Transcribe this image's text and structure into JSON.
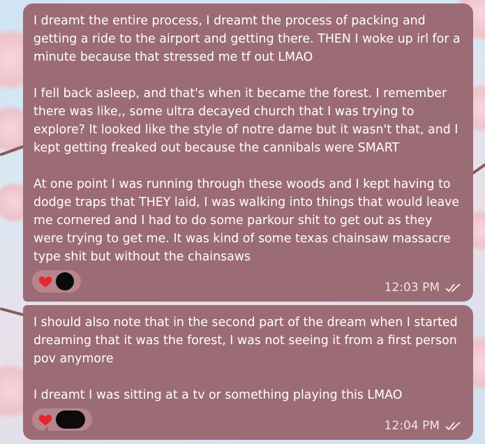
{
  "colors": {
    "bubble": "#9b6b76",
    "reaction_pill": "#b8858f",
    "text": "#ffffff",
    "time": "#f3e5e8",
    "heart": "#e8242f"
  },
  "messages": [
    {
      "paragraphs": [
        "I dreamt the entire process, I dreamt the process of packing and getting a ride to the airport and getting there. THEN I woke up irl for a minute because that stressed me tf out LMAO",
        "I fell back asleep, and that's when it became the forest. I remember there was like,, some ultra decayed church that I was trying to explore? It looked like the style of notre dame but it wasn't that, and I kept getting freaked out because the cannibals were SMART",
        "At one point I was running through these woods and I kept having to dodge traps that THEY laid, I was walking into things that would leave me cornered and I had to do some parkour shit to get out as they were trying to get me. It was kind of some texas chainsaw massacre type shit but without the chainsaws"
      ],
      "reaction": "heart-icon",
      "time": "12:03 PM",
      "status": "read-double-check-icon"
    },
    {
      "paragraphs": [
        "I should also note that in the second part of the dream when I started dreaming that it was the forest, I was not seeing it from a first person pov anymore",
        "I dreamt I was sitting at a tv or something playing this LMAO"
      ],
      "reaction": "heart-icon",
      "time": "12:04 PM",
      "status": "read-double-check-icon"
    }
  ]
}
